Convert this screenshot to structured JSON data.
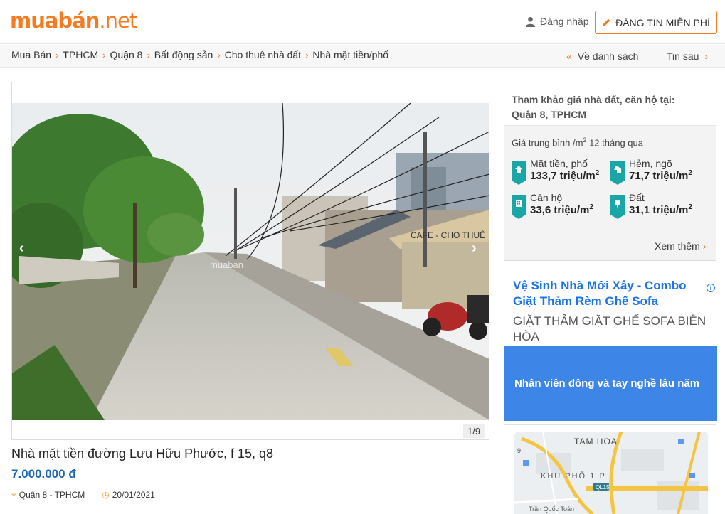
{
  "header": {
    "logo_main": "muabán",
    "logo_tld": ".net",
    "login_label": "Đăng nhập",
    "post_button_label": "ĐĂNG TIN MIỄN PHÍ"
  },
  "breadcrumb": {
    "items": [
      "Mua Bán",
      "TPHCM",
      "Quận 8",
      "Bất động sản",
      "Cho thuê nhà đất",
      "Nhà mặt tiền/phố"
    ],
    "back_label": "Về danh sách",
    "next_label": "Tin sau"
  },
  "gallery": {
    "counter": "1/9",
    "watermark": "muaban",
    "sign_text": "CAFE - CHO THUÊ"
  },
  "listing": {
    "title": "Nhà mặt tiền đường Lưu Hữu Phước, f 15, q8",
    "price": "7.000.000 đ",
    "location": "Quận 8 - TPHCM",
    "date": "20/01/2021"
  },
  "price_reference": {
    "heading_line1": "Tham khảo giá nhà đất, căn hộ tại:",
    "heading_line2": "Quận 8, TPHCM",
    "avg_label_prefix": "Giá trung bình /m",
    "avg_label_exp": "2",
    "avg_label_suffix": " 12 tháng qua",
    "stats": [
      {
        "label": "Mặt tiền, phố",
        "value": "133,7 triệu/m",
        "icon": "house-icon"
      },
      {
        "label": "Hẻm, ngõ",
        "value": "71,7 triệu/m",
        "icon": "alley-house-icon"
      },
      {
        "label": "Căn hộ",
        "value": "33,6 triệu/m",
        "icon": "building-icon"
      },
      {
        "label": "Đất",
        "value": "31,1 triệu/m",
        "icon": "tree-icon"
      }
    ],
    "unit_exp": "2",
    "more_label": "Xem thêm"
  },
  "ad": {
    "title": "Vệ Sinh Nhà Mới Xây - Combo Giặt Thảm Rèm Ghế Sofa",
    "subtitle": "GIẶT THẢM GIẶT GHẾ SOFA BIÊN HÒA",
    "cta": "Nhân viên đông và tay nghề lâu năm"
  },
  "map": {
    "labels": [
      "TAM HOA",
      "KHU PHỐ 1 P",
      "QL15",
      "Trần Quốc Toản",
      "9"
    ]
  },
  "colors": {
    "brand_orange": "#f47b20",
    "price_blue": "#1c66b5",
    "stat_teal": "#1aa6a6",
    "ad_blue": "#3d85e6"
  }
}
